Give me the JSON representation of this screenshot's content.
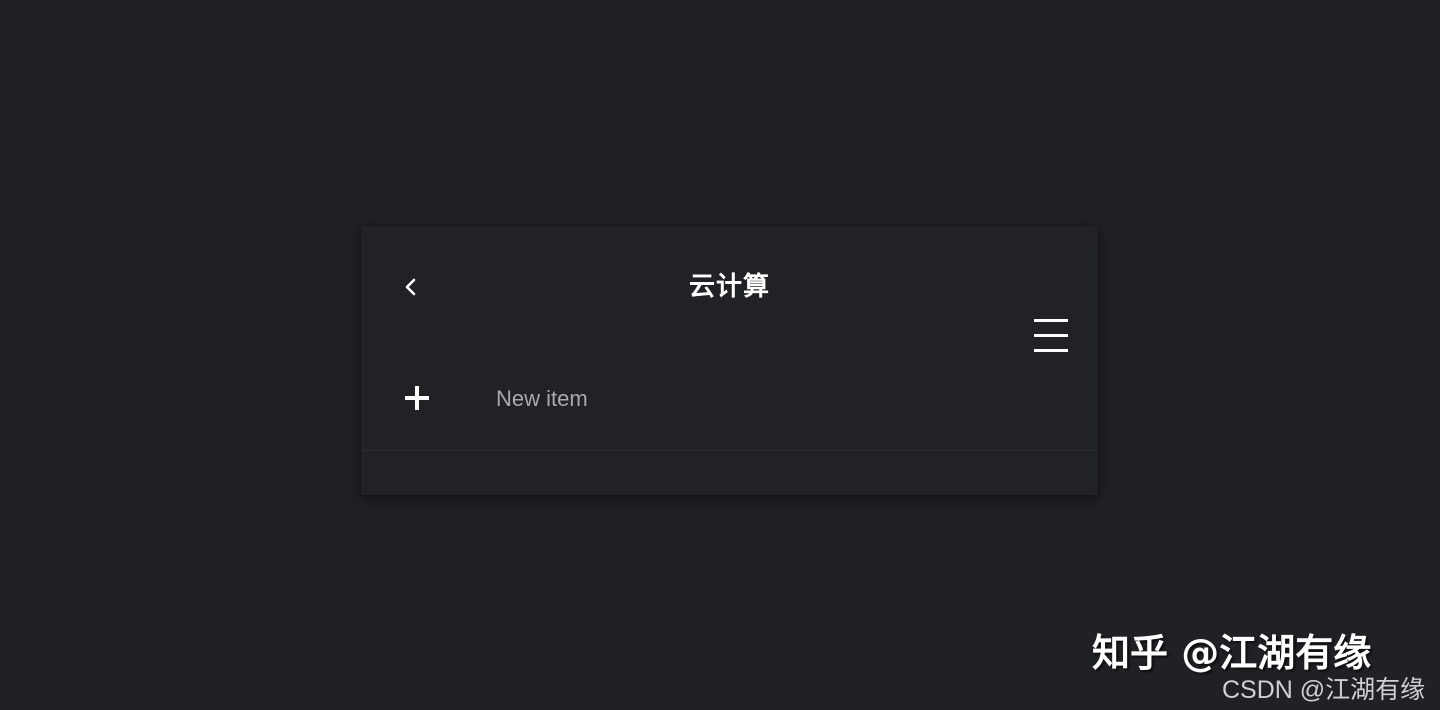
{
  "header": {
    "back_icon": "chevron-left-icon",
    "title": "云计算",
    "menu_icon": "hamburger-menu-icon"
  },
  "list": {
    "new_item": {
      "icon": "plus-icon",
      "label": "New item"
    }
  },
  "watermarks": {
    "zhihu": "知乎 @江湖有缘",
    "csdn": "CSDN @江湖有缘"
  },
  "colors": {
    "background": "#202125",
    "card": "#212226",
    "title": "#ffffff",
    "item_label": "#a8a9ad"
  }
}
